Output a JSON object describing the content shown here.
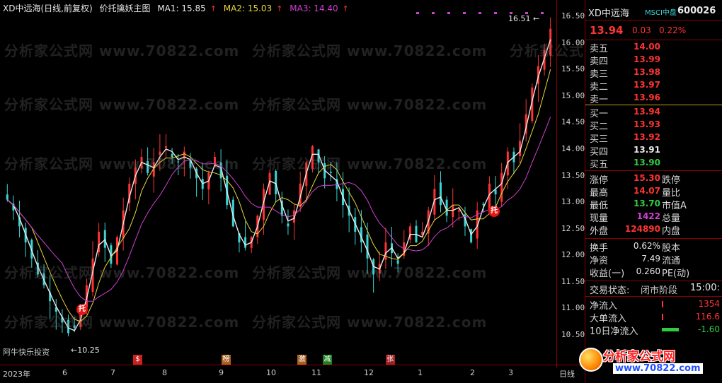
{
  "title": {
    "stock": "XD中远海(日线,前复权)",
    "indicator": "价托擒妖主图",
    "ma1_label": "MA1: 15.85",
    "ma2_label": "MA2: 15.03",
    "ma3_label": "MA3: 14.40",
    "arrow": "↑"
  },
  "colors": {
    "up": "#ff3333",
    "down": "#3ad4d4",
    "ma1": "#e8e8e8",
    "ma2": "#e6d83c",
    "ma3": "#d040d0",
    "grid": "#8b0000"
  },
  "price_axis": [
    "16.50",
    "16.00",
    "15.50",
    "15.00",
    "14.50",
    "14.00",
    "13.50",
    "13.00",
    "12.50",
    "12.00",
    "11.50",
    "11.00",
    "10.50"
  ],
  "date_axis": [
    "2023年",
    "6",
    "7",
    "8",
    "9",
    "10",
    "11",
    "12",
    "1",
    "2",
    "3",
    "日线"
  ],
  "annotations": {
    "peak": "16.51",
    "low": "10.25",
    "author": "阿牛快乐投资",
    "tuo": "托"
  },
  "watermark": "分析家公式网 www.70822.com",
  "events": [
    {
      "label": "$",
      "color": "#cc2020"
    },
    {
      "label": "榜",
      "color": "#a86020"
    },
    {
      "label": "激",
      "color": "#a86020"
    },
    {
      "label": "减",
      "color": "#208020"
    },
    {
      "label": "张",
      "color": "#a02020"
    }
  ],
  "chart_data": {
    "type": "candlestick",
    "ylim": [
      10.25,
      16.6
    ],
    "x_labels": [
      "6",
      "7",
      "8",
      "9",
      "10",
      "11",
      "12",
      "1",
      "2",
      "3"
    ],
    "ma1": 15.85,
    "ma2": 15.03,
    "ma3": 14.4,
    "high": 16.51,
    "low": 10.25,
    "close_series": [
      13.1,
      12.9,
      12.6,
      12.3,
      12.0,
      11.7,
      11.5,
      11.2,
      11.0,
      10.8,
      10.6,
      10.7,
      11.0,
      11.5,
      12.0,
      12.5,
      12.2,
      11.9,
      12.4,
      12.9,
      13.4,
      13.7,
      13.9,
      13.6,
      13.8,
      14.0,
      14.1,
      13.9,
      13.8,
      14.0,
      13.7,
      13.5,
      13.3,
      13.6,
      13.9,
      13.5,
      13.0,
      12.6,
      12.3,
      12.2,
      12.4,
      12.8,
      13.3,
      13.6,
      13.2,
      12.8,
      12.6,
      12.9,
      13.4,
      13.8,
      14.1,
      13.8,
      13.5,
      13.6,
      13.3,
      13.0,
      12.8,
      12.5,
      12.3,
      12.0,
      11.7,
      11.9,
      12.3,
      12.1,
      11.9,
      12.3,
      12.6,
      12.3,
      12.5,
      12.9,
      13.3,
      13.0,
      12.8,
      13.0,
      12.9,
      12.6,
      12.3,
      12.9,
      13.0,
      13.4,
      13.2,
      13.6,
      14.0,
      13.8,
      14.2,
      14.7,
      15.2,
      15.6,
      15.9,
      16.3
    ]
  },
  "panel": {
    "name": "XD中远海",
    "msci": "MSCI中盘",
    "code": "600026",
    "price": "13.94",
    "change": "0.03",
    "change_pct": "0.22%",
    "asks": [
      {
        "label": "卖五",
        "price": "14.00"
      },
      {
        "label": "卖四",
        "price": "13.99"
      },
      {
        "label": "卖三",
        "price": "13.98"
      },
      {
        "label": "卖二",
        "price": "13.97"
      },
      {
        "label": "卖一",
        "price": "13.96"
      }
    ],
    "bids": [
      {
        "label": "买一",
        "price": "13.94"
      },
      {
        "label": "买二",
        "price": "13.93"
      },
      {
        "label": "买三",
        "price": "13.92"
      },
      {
        "label": "买四",
        "price": "13.91"
      },
      {
        "label": "买五",
        "price": "13.90"
      }
    ],
    "stats": [
      {
        "l1": "涨停",
        "v1": "15.30",
        "l2": "跌停",
        "v2": ""
      },
      {
        "l1": "最高",
        "v1": "14.07",
        "l2": "量比",
        "v2": ""
      },
      {
        "l1": "最低",
        "v1": "13.70",
        "l2": "市值A",
        "v2": ""
      },
      {
        "l1": "现量",
        "v1": "1422",
        "l2": "总量",
        "v2": ""
      },
      {
        "l1": "外盘",
        "v1": "124890",
        "l2": "内盘",
        "v2": ""
      }
    ],
    "fundamentals": [
      {
        "l1": "换手",
        "v1": "0.62%",
        "l2": "股本"
      },
      {
        "l1": "净资",
        "v1": "7.49",
        "l2": "流通"
      },
      {
        "l1": "收益(一)",
        "v1": "0.260",
        "l2": "PE(动)"
      }
    ],
    "trade_status_label": "交易状态:",
    "trade_status": "闭市阶段",
    "trade_time": "15:00:",
    "flows": [
      {
        "label": "净流入",
        "value": "1354"
      },
      {
        "label": "大单流入",
        "value": "116.6"
      },
      {
        "label": "10日净流入",
        "value": "-1.60"
      }
    ]
  },
  "logo": {
    "main": "分析家公式网",
    "url": "www.70822.com"
  }
}
